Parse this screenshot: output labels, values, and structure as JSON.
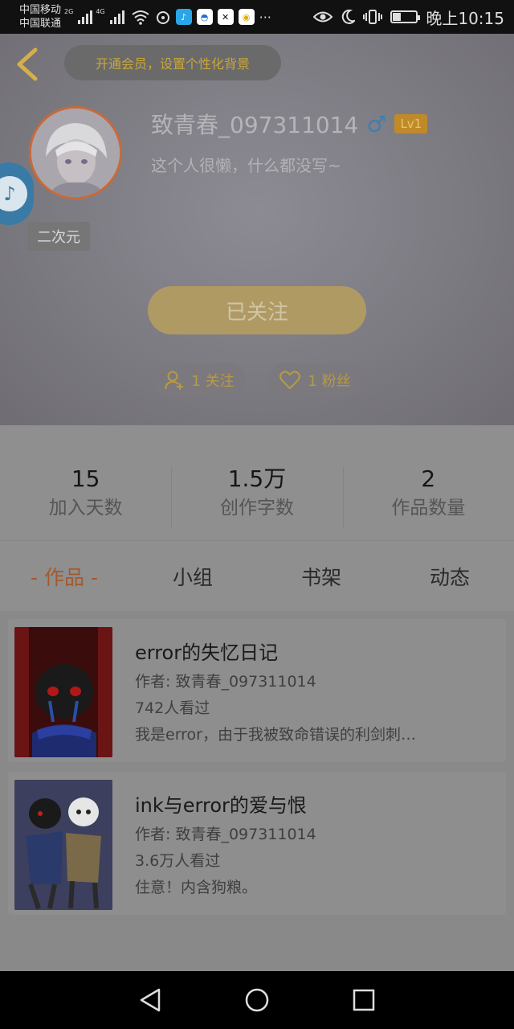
{
  "status_bar": {
    "carrier1": "中国移动",
    "carrier2": "中国联通",
    "net1": "2G",
    "net2": "4G",
    "more": "···",
    "time": "晚上10:15"
  },
  "header": {
    "vip_prompt": "开通会员，设置个性化背景",
    "username": "致青春_097311014",
    "gender_symbol": "♂",
    "level": "Lv1",
    "bio": "这个人很懒，什么都没写~",
    "tag": "二次元",
    "follow_button": "已关注",
    "following_count": "1 关注",
    "fans_count": "1 粉丝"
  },
  "stats": [
    {
      "value": "15",
      "label": "加入天数"
    },
    {
      "value": "1.5万",
      "label": "创作字数"
    },
    {
      "value": "2",
      "label": "作品数量"
    }
  ],
  "tabs": [
    {
      "label": "- 作品 -",
      "active": true
    },
    {
      "label": "小组",
      "active": false
    },
    {
      "label": "书架",
      "active": false
    },
    {
      "label": "动态",
      "active": false
    }
  ],
  "works": [
    {
      "title": "error的失忆日记",
      "author": "作者: 致青春_097311014",
      "views": "742人看过",
      "desc": "我是error，由于我被致命错误的利剑刺…"
    },
    {
      "title": "ink与error的爱与恨",
      "author": "作者: 致青春_097311014",
      "views": "3.6万人看过",
      "desc": "住意！内含狗粮。"
    }
  ],
  "colors": {
    "accent_gold": "#c9a63b",
    "active_tab": "#a4592c",
    "avatar_ring": "#c86a3a",
    "gender_blue": "#3e7fb0"
  }
}
